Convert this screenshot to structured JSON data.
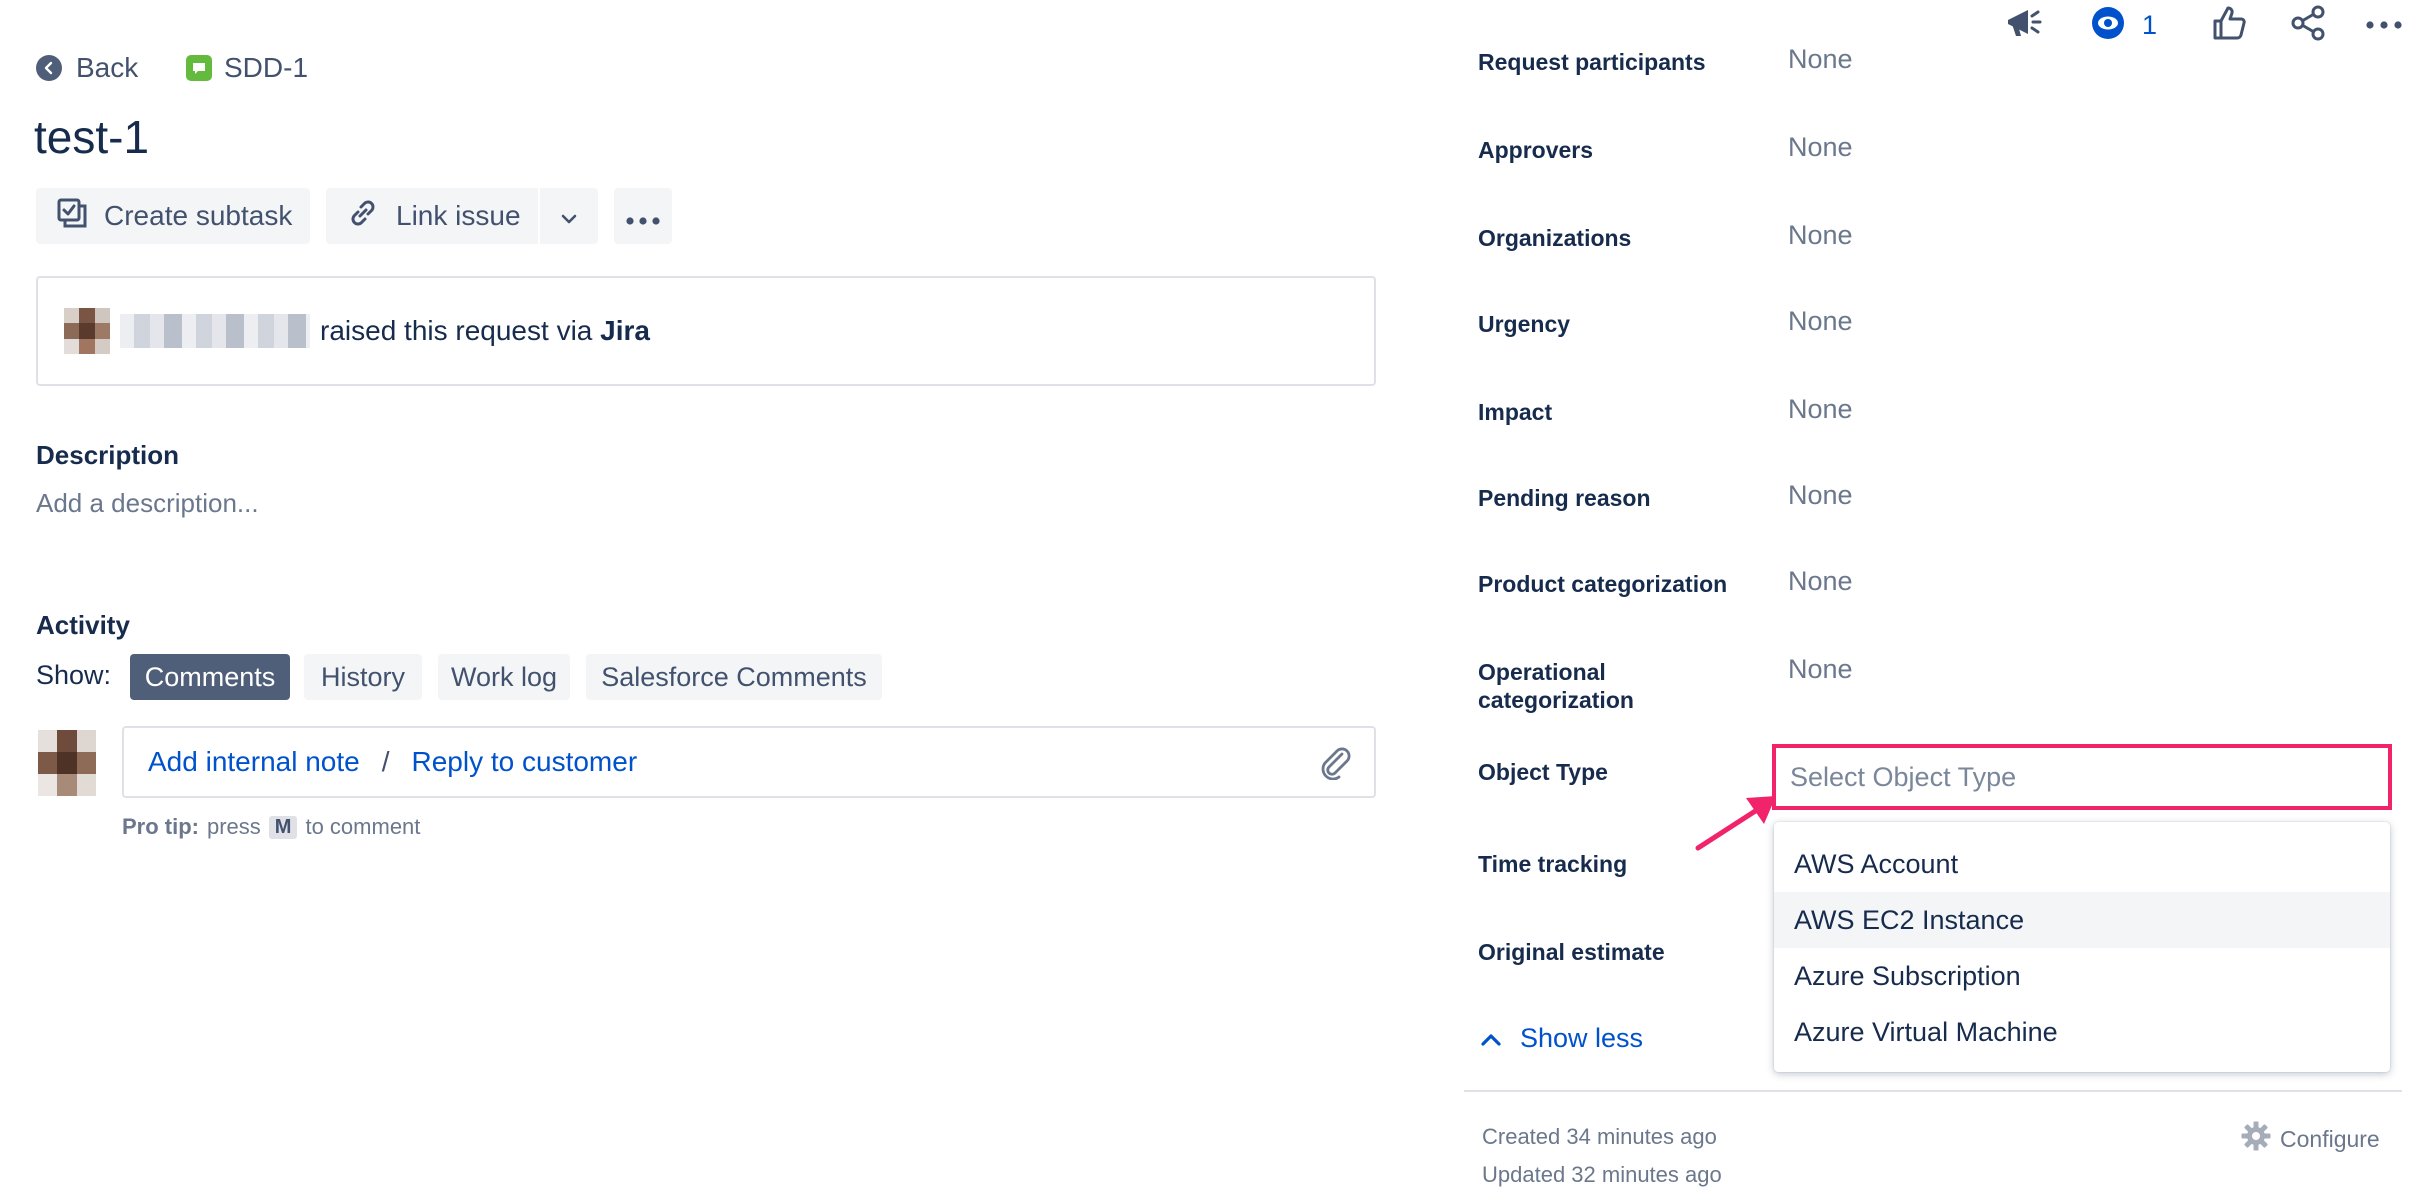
{
  "header": {
    "back_label": "Back",
    "issue_key": "SDD-1",
    "title": "test-1",
    "watch_count": "1"
  },
  "toolbar": {
    "create_subtask_label": "Create subtask",
    "link_issue_label": "Link issue"
  },
  "request": {
    "raised_text": "raised this request via",
    "channel": "Jira"
  },
  "description": {
    "heading": "Description",
    "placeholder": "Add a description..."
  },
  "activity": {
    "heading": "Activity",
    "show_label": "Show:",
    "tabs": [
      {
        "label": "Comments",
        "active": true
      },
      {
        "label": "History",
        "active": false
      },
      {
        "label": "Work log",
        "active": false
      },
      {
        "label": "Salesforce Comments",
        "active": false
      }
    ],
    "add_internal_note": "Add internal note",
    "separator": "/",
    "reply_to_customer": "Reply to customer",
    "pro_tip_label": "Pro tip:",
    "pro_tip_press": "press",
    "pro_tip_key": "M",
    "pro_tip_suffix": "to comment"
  },
  "fields": [
    {
      "label": "Request participants",
      "value": "None"
    },
    {
      "label": "Approvers",
      "value": "None"
    },
    {
      "label": "Organizations",
      "value": "None"
    },
    {
      "label": "Urgency",
      "value": "None"
    },
    {
      "label": "Impact",
      "value": "None"
    },
    {
      "label": "Pending reason",
      "value": "None"
    },
    {
      "label": "Product categorization",
      "value": "None"
    },
    {
      "label_line1": "Operational",
      "label_line2": "categorization",
      "value": "None"
    },
    {
      "label": "Object Type",
      "value": ""
    },
    {
      "label": "Time tracking",
      "value": ""
    },
    {
      "label": "Original estimate",
      "value": ""
    }
  ],
  "object_type_select": {
    "placeholder": "Select Object Type",
    "options": [
      "AWS Account",
      "AWS EC2 Instance",
      "Azure Subscription",
      "Azure Virtual Machine"
    ],
    "highlighted_option": "AWS EC2 Instance"
  },
  "show_less_label": "Show less",
  "footer": {
    "created": "Created 34 minutes ago",
    "updated": "Updated 32 minutes ago",
    "configure_label": "Configure"
  },
  "icons": [
    "announcement-icon",
    "watch-eye-icon",
    "thumbs-up-icon",
    "share-icon",
    "more-icon",
    "paperclip-icon",
    "gear-icon",
    "chevron-up-icon"
  ],
  "colors": {
    "primary_link": "#0052CC",
    "text": "#172B4D",
    "subtle_text": "#6B778C",
    "annotation": "#F1236A",
    "issue_type_green": "#63BA3C"
  }
}
